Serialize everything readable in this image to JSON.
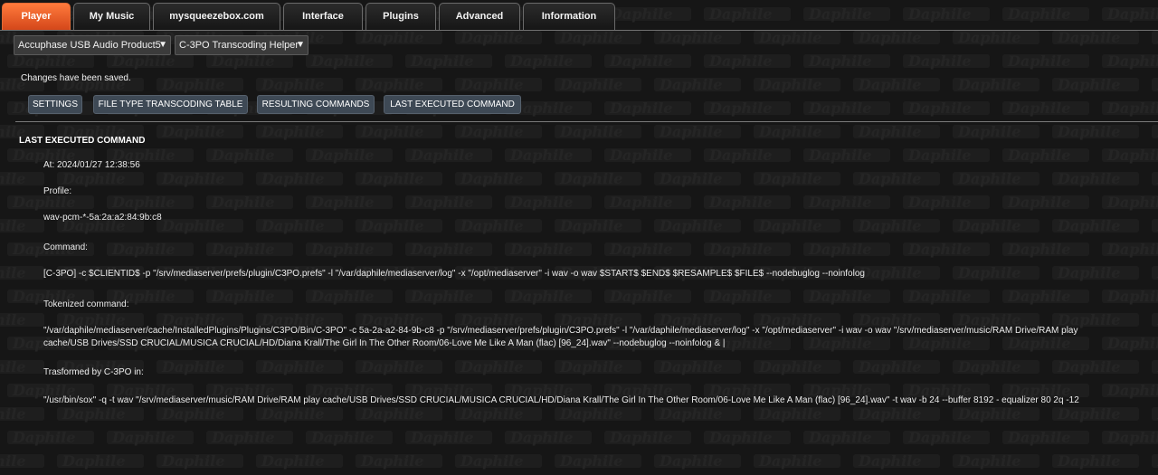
{
  "tabs": [
    {
      "label": "Player",
      "active": true
    },
    {
      "label": "My Music",
      "active": false
    },
    {
      "label": "mysqueezebox.com",
      "active": false
    },
    {
      "label": "Interface",
      "active": false
    },
    {
      "label": "Plugins",
      "active": false
    },
    {
      "label": "Advanced",
      "active": false
    },
    {
      "label": "Information",
      "active": false
    }
  ],
  "player_select": {
    "value": "Accuphase USB Audio Product5"
  },
  "plugin_select": {
    "value": "C-3PO Transcoding Helper"
  },
  "caret_icon": "▼",
  "status_message": "Changes have been saved.",
  "buttons": {
    "settings": "SETTINGS",
    "file_type_table": "FILE TYPE TRANSCODING TABLE",
    "resulting_commands": "RESULTING COMMANDS",
    "last_executed": "LAST EXECUTED COMMAND"
  },
  "section": {
    "title": "LAST EXECUTED COMMAND",
    "at_label": "At: 2024/01/27 12:38:56",
    "profile_label": "Profile:",
    "profile_value": "wav-pcm-*-5a:2a:a2:84:9b:c8",
    "command_label": "Command:",
    "command_value": "[C-3PO] -c $CLIENTID$ -p \"/srv/mediaserver/prefs/plugin/C3PO.prefs\" -l \"/var/daphile/mediaserver/log\" -x \"/opt/mediaserver\" -i wav -o wav $START$ $END$ $RESAMPLE$ $FILE$ --nodebuglog --noinfolog",
    "tokenized_label": "Tokenized command:",
    "tokenized_value": "\"/var/daphile/mediaserver/cache/InstalledPlugins/Plugins/C3PO/Bin/C-3PO\" -c 5a-2a-a2-84-9b-c8 -p \"/srv/mediaserver/prefs/plugin/C3PO.prefs\" -l \"/var/daphile/mediaserver/log\" -x \"/opt/mediaserver\" -i wav -o wav \"/srv/mediaserver/music/RAM Drive/RAM play cache/USB Drives/SSD CRUCIAL/MUSICA CRUCIAL/HD/Diana Krall/The Girl In The Other Room/06-Love Me Like A Man (flac) [96_24].wav\" --nodebuglog --noinfolog & |",
    "transformed_label": "Trasformed by C-3PO in:",
    "transformed_value": "\"/usr/bin/sox\" -q -t wav \"/srv/mediaserver/music/RAM Drive/RAM play cache/USB Drives/SSD CRUCIAL/MUSICA CRUCIAL/HD/Diana Krall/The Girl In The Other Room/06-Love Me Like A Man (flac) [96_24].wav\" -t wav -b 24 --buffer 8192 - equalizer 80 2q -12"
  },
  "background": {
    "watermark": "Daphile",
    "color": "#161616",
    "accent": "#e05a24"
  }
}
